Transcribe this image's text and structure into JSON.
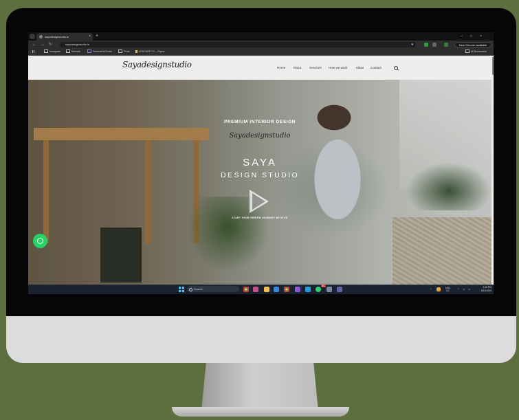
{
  "browser": {
    "tab_title": "sayadesignstudio.in",
    "tab_close": "×",
    "new_tab": "+",
    "window_controls": "–□×",
    "url": "sayadesignstudio.in",
    "update_label": "New Chrome available",
    "nav": {
      "back": "←",
      "forward": "→",
      "reload": "↻"
    },
    "bookmark_star": "★",
    "bookmarks": [
      {
        "label": "Instagram"
      },
      {
        "label": "Website"
      },
      {
        "label": "VentureBis Email"
      },
      {
        "label": "Tools"
      },
      {
        "label": "VENTURE CC – Figma"
      }
    ],
    "all_bookmarks": "All Bookmarks"
  },
  "site": {
    "logo": "Sayadesignstudio",
    "nav": [
      "Home",
      "About",
      "Services",
      "How we work",
      "Ideas",
      "Contact"
    ]
  },
  "hero": {
    "eyebrow": "PREMIUM INTERIOR DESIGN",
    "script_logo": "Sayadesignstudio",
    "title": "SAYA",
    "subtitle": "DESIGN STUDIO",
    "cta": "START YOUR DESIGN JOURNEY WITH US"
  },
  "taskbar": {
    "search_placeholder": "Search",
    "badge": "99+",
    "tray_arrow": "^",
    "lang_line1": "ENG",
    "lang_line2": "US",
    "time": "2:48 PM",
    "date": "8/15/2025"
  },
  "colors": {
    "background": "#5d6e3f",
    "whatsapp": "#25d366",
    "taskbar": "#1b2230"
  }
}
